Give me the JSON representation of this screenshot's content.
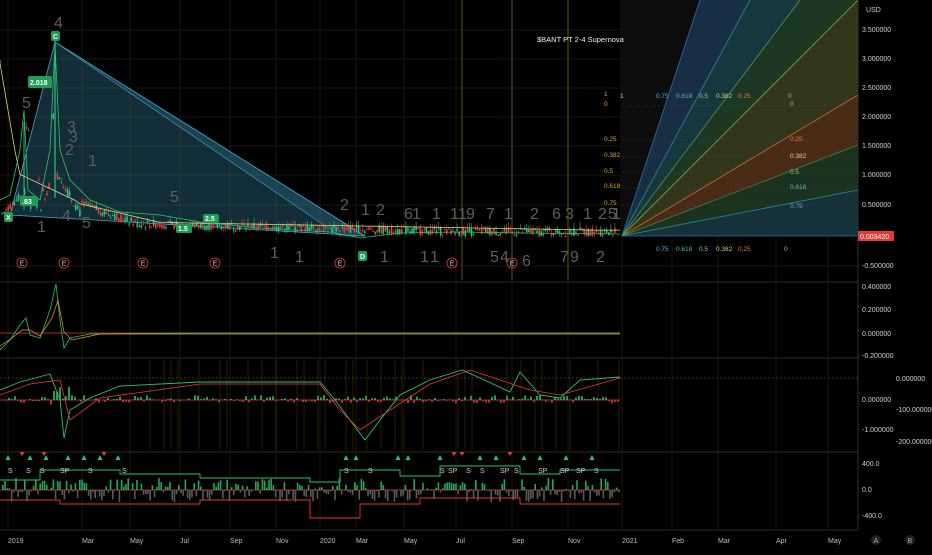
{
  "chart_title": "$BANT PT 2-4 Supernova",
  "currency": "USD",
  "last_price": "0.003420",
  "time_labels": [
    "2019",
    "Mar",
    "May",
    "Jul",
    "Sep",
    "Nov",
    "2020",
    "Mar",
    "May",
    "Jul",
    "Sep",
    "Nov",
    "2021",
    "Feb",
    "Mar",
    "Apr",
    "May"
  ],
  "corner_buttons": [
    "A",
    "B"
  ],
  "price_axis": [
    "3.500000",
    "3.000000",
    "2.500000",
    "2.000000",
    "1.500000",
    "1.000000",
    "0.500000",
    "-0.500000"
  ],
  "osc1_axis": [
    "0.400000",
    "0.200000",
    "0.000000",
    "-0.200000"
  ],
  "osc2_axis_left": [
    "0.000000",
    "-1.000000"
  ],
  "osc2_axis_right": [
    "0.000000",
    "-100.000000",
    "-200.000000"
  ],
  "osc3_axis": [
    "400.0",
    "0.0",
    "-400.0"
  ],
  "fib_levels": [
    "0",
    "0.25",
    "0.382",
    "0.5",
    "0.618",
    "0.75",
    "1"
  ],
  "fib_top_row": [
    "1",
    "0.75",
    "0.618",
    "0.5",
    "0.382",
    "0.25",
    "0"
  ],
  "fib_bottom_row": [
    "0.75",
    "0.618",
    "0.5",
    "0.382",
    "0.25",
    "0"
  ],
  "fan_right_labels": [
    "0",
    "0.25",
    "0.382",
    "0.5",
    "0.618",
    "0.75"
  ],
  "annotations": [
    "2.018",
    ".83",
    "1.5",
    "2.5",
    "C",
    "X",
    "D"
  ],
  "wave_digits": [
    "5",
    "4",
    "3",
    "2",
    "1",
    "3",
    "1",
    "4",
    "5",
    "5",
    "2",
    "1",
    "2",
    "6",
    "1",
    "1",
    "1",
    "1",
    "9",
    "7",
    "1",
    "2",
    "6",
    "3",
    "1",
    "2",
    "5",
    "1",
    "1",
    "1",
    "1",
    "1",
    "1",
    "5",
    "4",
    "7",
    "9",
    "2",
    "6"
  ],
  "earnings_marker": "E",
  "signal_labels": [
    "S",
    "SP"
  ],
  "chart_data": {
    "type": "line",
    "title": "$BANT PT 2-4 Supernova",
    "x": [
      "2019",
      "Mar",
      "May",
      "Jul",
      "Sep",
      "Nov",
      "2020",
      "Mar",
      "May",
      "Jul",
      "Sep",
      "Nov",
      "2021"
    ],
    "series": [
      {
        "values": [
          0.35,
          0.6,
          1.0,
          1.1,
          0.4,
          0.2,
          0.12,
          0.08,
          0.05,
          0.03,
          0.02,
          0.015,
          0.003
        ]
      }
    ],
    "ylim": [
      -0.5,
      3.8
    ],
    "peaks": {
      "pattern_C": 3.25,
      "annotated_high": 2.018
    },
    "last_value": 0.00342,
    "grid": true
  }
}
